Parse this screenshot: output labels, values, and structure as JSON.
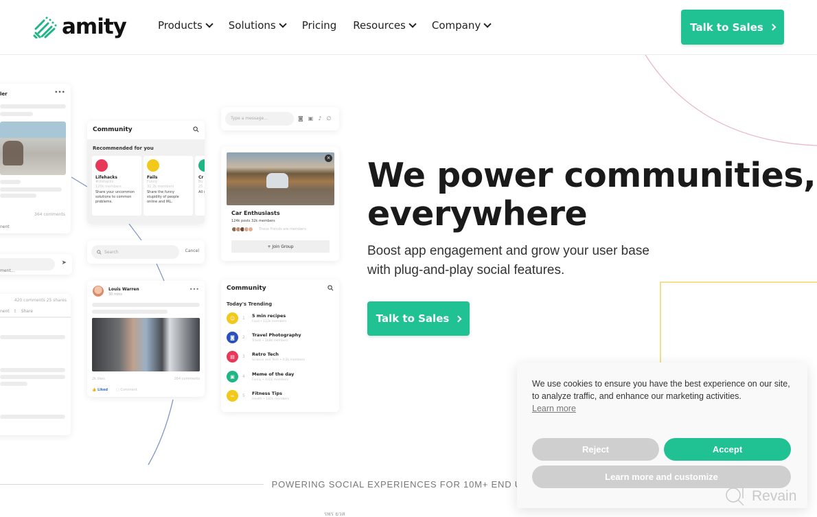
{
  "brand": {
    "name": "amity",
    "accent_color": "#20c193"
  },
  "nav": {
    "items": [
      {
        "label": "Products",
        "has_dropdown": true
      },
      {
        "label": "Solutions",
        "has_dropdown": true
      },
      {
        "label": "Pricing",
        "has_dropdown": false
      },
      {
        "label": "Resources",
        "has_dropdown": true
      },
      {
        "label": "Company",
        "has_dropdown": true
      }
    ],
    "cta_label": "Talk to Sales"
  },
  "hero": {
    "title_line1": "We power communities,",
    "title_line2": "everywhere",
    "subtitle_line1": "Boost app engagement and grow your user base",
    "subtitle_line2": "with plug-and-play social features.",
    "cta_label": "Talk to Sales"
  },
  "mockups": {
    "left_post": {
      "title_fragment": "ler",
      "comments": "364 comments",
      "action_fragment": "nent"
    },
    "comment_input": {
      "placeholder_fragment": "ment..."
    },
    "comments_panel": {
      "stats": "420 comments  25 shares",
      "actions": [
        "nent",
        "Share"
      ]
    },
    "community_recommended": {
      "title": "Community",
      "section": "Recommended for you",
      "tiles": [
        {
          "name": "Lifehacks",
          "category": "#lifehacks",
          "members": "120k members",
          "desc": "Share your uncommon solutions to common problems.",
          "color": "#e8385a"
        },
        {
          "name": "Fails",
          "category": "Funny",
          "members": "32.2k members",
          "desc": "Share the funny stupidity of people online and IRL.",
          "color": "#f2c81a"
        },
        {
          "name": "Cr",
          "category": "Bu",
          "members": "25",
          "desc": "All se sto",
          "color": "#1fb585"
        }
      ]
    },
    "search": {
      "placeholder": "Search",
      "cancel_label": "Cancel"
    },
    "post": {
      "author": "Louis Warren",
      "time": "30 mins",
      "likes": "2k likes",
      "comments": "264 comments",
      "liked_label": "Liked",
      "comment_label": "Comment"
    },
    "message": {
      "placeholder": "Type a message..."
    },
    "group": {
      "name": "Car Enthusiasts",
      "stats": "124k posts   32k members",
      "friends_text": "These friends are members",
      "join_label": "+ Join Group",
      "close_label": "×"
    },
    "trending": {
      "title": "Community",
      "section": "Today's Trending",
      "items": [
        {
          "rank": "1",
          "name": "5 min recipes",
          "meta": "Food • 112k members",
          "color": "#f2c81a"
        },
        {
          "rank": "2",
          "name": "Travel Photography",
          "meta": "Travel • 168k members",
          "color": "#2a4fbf"
        },
        {
          "rank": "3",
          "name": "Retro Tech",
          "meta": "Science and Tech • 4.2k members",
          "color": "#e8385a"
        },
        {
          "rank": "4",
          "name": "Meme of the day",
          "meta": "Funny • 432k members",
          "color": "#1fb585"
        },
        {
          "rank": "5",
          "name": "Fitness Tips",
          "meta": "Health • 182k members",
          "color": "#f2c81a"
        }
      ]
    }
  },
  "powering": {
    "text": "POWERING SOCIAL EXPERIENCES FOR 10M+ END U",
    "logos_hint": "รพร  ยวส"
  },
  "cookie_banner": {
    "text": "We use cookies to ensure you have the best experience on our site, to analyze traffic, and enhance our marketing activities.",
    "learn_more": "Learn more",
    "reject_label": "Reject",
    "accept_label": "Accept",
    "customize_label": "Learn more and customize"
  },
  "watermark": {
    "label": "Revain"
  }
}
